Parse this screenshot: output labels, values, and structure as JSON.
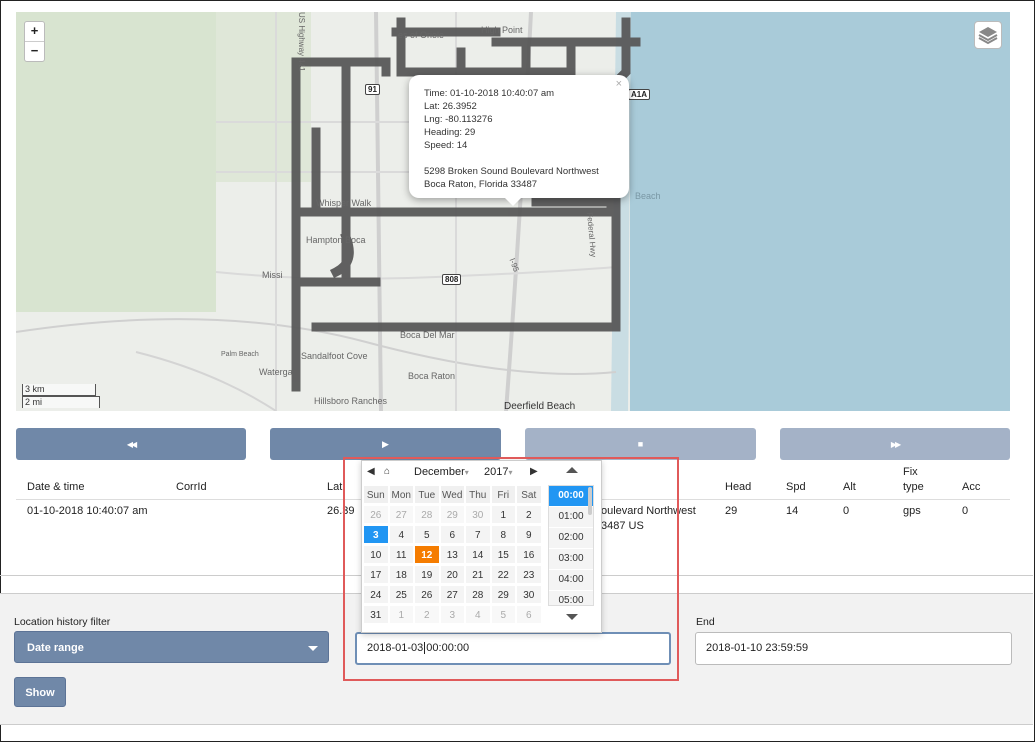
{
  "map": {
    "zoom_in": "+",
    "zoom_out": "−",
    "scale_km": "3 km",
    "scale_mi": "2 mi",
    "popup": {
      "time": "Time: 01-10-2018 10:40:07 am",
      "lat": "Lat: 26.3952",
      "lng": "Lng: -80.113276",
      "heading": "Heading: 29",
      "speed": "Speed: 14",
      "address1": "5298 Broken Sound Boulevard Northwest",
      "address2": "Boca Raton, Florida 33487",
      "close": "×"
    },
    "labels": {
      "orchard": "es of Oriole",
      "highpoint": "High Point",
      "whisper": "Whisper Walk",
      "hampton": "Hampton Boca",
      "mission": "Missi",
      "palm": "Palm Beach",
      "sandalfoot": "Sandalfoot Cove",
      "waterg": "Waterga",
      "hillsboro": "Hillsboro Ranches",
      "bocaraton": "Boca Raton",
      "bocadelmar": "Boca Del Mar",
      "deerfield": "Deerfield Beach",
      "beach": "Beach",
      "federal": "Federal Hwy",
      "i95": "I-95",
      "hwy441": "US Highway 441",
      "shield91": "91",
      "shield808": "808",
      "shielda1a": "A1A"
    }
  },
  "controls": {
    "rewind": "◀◀",
    "play": "▶",
    "stop": "■",
    "forward": "▶▶"
  },
  "table": {
    "headers": {
      "datetime": "Date & time",
      "corrid": "CorrId",
      "lat": "Lat",
      "address": "",
      "head": "Head",
      "spd": "Spd",
      "alt": "Alt",
      "fix1": "Fix",
      "fix2": "type",
      "acc": "Acc"
    },
    "row": {
      "datetime": "01-10-2018 10:40:07 am",
      "lat": "26.39",
      "address1": "oulevard Northwest",
      "address2": "3487 US",
      "head": "29",
      "spd": "14",
      "alt": "0",
      "fix": "gps",
      "acc": "0"
    }
  },
  "filter": {
    "label": "Location history filter",
    "select_value": "Date range",
    "end_label": "End",
    "start_value_date": "2018-01-03",
    "start_value_time": "00:00:00",
    "end_value": "2018-01-10 23:59:59",
    "show_button": "Show"
  },
  "datepicker": {
    "prev": "◀",
    "home": "⌂",
    "month": "December",
    "year": "2017",
    "next": "▶",
    "dropdown": "▾",
    "days_of_week": [
      "Sun",
      "Mon",
      "Tue",
      "Wed",
      "Thu",
      "Fri",
      "Sat"
    ],
    "weeks": [
      [
        "26",
        "27",
        "28",
        "29",
        "30",
        "1",
        "2"
      ],
      [
        "3",
        "4",
        "5",
        "6",
        "7",
        "8",
        "9"
      ],
      [
        "10",
        "11",
        "12",
        "13",
        "14",
        "15",
        "16"
      ],
      [
        "17",
        "18",
        "19",
        "20",
        "21",
        "22",
        "23"
      ],
      [
        "24",
        "25",
        "26",
        "27",
        "28",
        "29",
        "30"
      ],
      [
        "31",
        "1",
        "2",
        "3",
        "4",
        "5",
        "6"
      ]
    ],
    "selected_day": "3",
    "today_day": "12",
    "times": [
      "00:00",
      "01:00",
      "02:00",
      "03:00",
      "04:00",
      "05:00"
    ],
    "selected_time": "00:00",
    "colors": {
      "selected": "#2196f3",
      "today": "#f57c00",
      "highlight_box": "#e05a5a"
    }
  }
}
